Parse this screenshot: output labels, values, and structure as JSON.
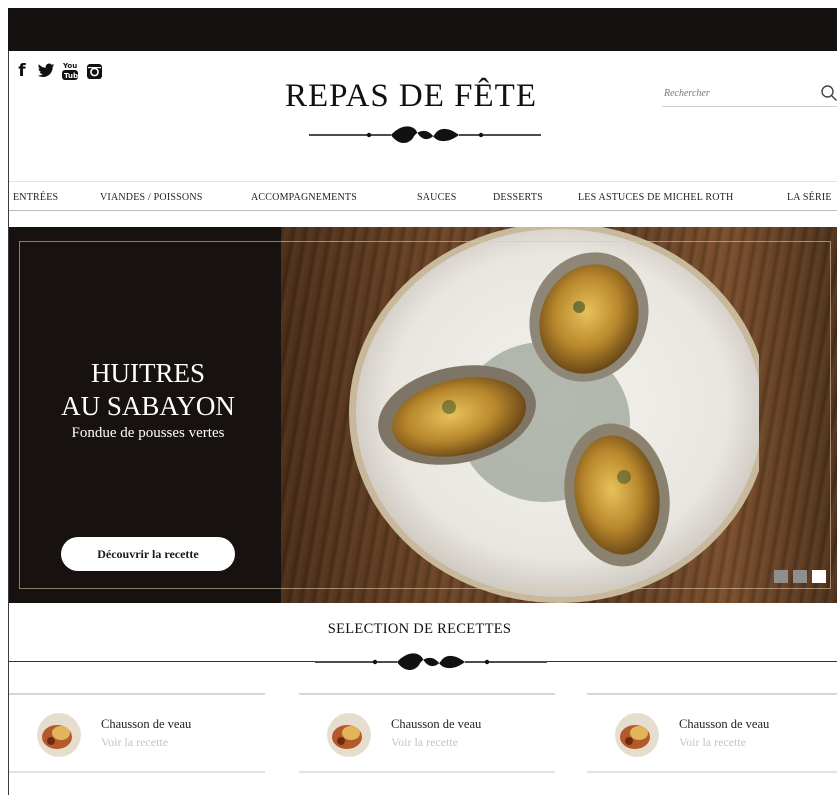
{
  "site": {
    "title": "REPAS DE FÊTE"
  },
  "social": [
    {
      "name": "facebook-icon",
      "glyph": "f"
    },
    {
      "name": "twitter-icon",
      "glyph": ""
    },
    {
      "name": "youtube-icon",
      "glyph": ""
    },
    {
      "name": "instagram-icon",
      "glyph": ""
    }
  ],
  "search": {
    "placeholder": "Rechercher"
  },
  "nav": {
    "items": [
      "ENTRÉES",
      "VIANDES / POISSONS",
      "ACCOMPAGNEMENTS",
      "SAUCES",
      "DESSERTS",
      "LES ASTUCES DE MICHEL ROTH",
      "LA SÉRIE"
    ]
  },
  "hero": {
    "title_line1": "HUITRES",
    "title_line2": "AU SABAYON",
    "subtitle": "Fondue de pousses vertes",
    "button": "Découvrir la recette",
    "slide_active": 3,
    "slide_count": 3
  },
  "selection": {
    "title": "SELECTION DE RECETTES",
    "cards": [
      {
        "name": "Chausson de veau",
        "link": "Voir la recette"
      },
      {
        "name": "Chausson de veau",
        "link": "Voir la recette"
      },
      {
        "name": "Chausson de veau",
        "link": "Voir la recette"
      }
    ]
  },
  "colors": {
    "topbar": "#151111",
    "hero_panel": "#17120f",
    "link_muted": "#c9c4bd"
  }
}
